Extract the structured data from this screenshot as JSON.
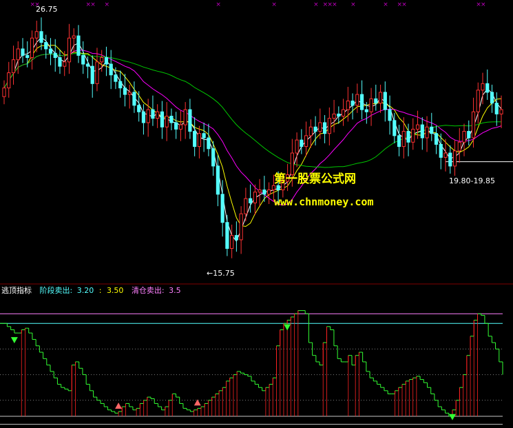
{
  "chart_data": [
    {
      "type": "candlestick",
      "annotations": {
        "high_label": "26.75",
        "low_label": "←15.75",
        "range_label": "19.80-19.85"
      },
      "watermark": {
        "line1": "第一股票公式网",
        "line2": "www.chnmoney.com"
      },
      "price_range": [
        15.2,
        27.4
      ],
      "range_line_price": 20.2,
      "colors": {
        "up": "#ff3232",
        "down": "#54ffff",
        "ma_fast": "#ffffff",
        "ma_mid": "#ffff00",
        "ma_slow": "#ff00ff",
        "ma_long": "#00c800",
        "mark_x": "#c000c0"
      },
      "close": [
        23.6,
        24.3,
        24.9,
        25.4,
        25.1,
        25.0,
        25.9,
        26.2,
        25.7,
        25.4,
        25.2,
        25.0,
        24.6,
        24.8,
        25.9,
        26.0,
        25.1,
        24.7,
        24.6,
        23.8,
        24.8,
        25.0,
        24.7,
        24.2,
        23.9,
        23.6,
        23.3,
        23.4,
        22.8,
        22.5,
        22.0,
        22.6,
        22.2,
        22.5,
        21.8,
        22.3,
        22.0,
        21.7,
        21.9,
        22.6,
        21.6,
        20.9,
        21.5,
        21.3,
        20.8,
        20.0,
        18.7,
        17.4,
        16.2,
        16.8,
        16.6,
        17.8,
        18.5,
        18.3,
        18.8,
        18.9,
        18.7,
        18.9,
        19.1,
        18.9,
        19.3,
        19.6,
        20.6,
        21.2,
        20.9,
        21.4,
        21.8,
        21.6,
        22.0,
        21.5,
        22.2,
        22.4,
        22.3,
        22.6,
        23.0,
        22.8,
        23.3,
        22.6,
        22.5,
        23.1,
        22.9,
        23.4,
        22.6,
        22.1,
        21.4,
        20.9,
        21.6,
        21.1,
        21.7,
        21.9,
        21.3,
        21.8,
        21.5,
        21.0,
        20.4,
        20.6,
        20.0,
        20.7,
        21.1,
        21.6,
        21.3,
        22.5,
        23.5,
        23.8,
        23.4,
        22.9,
        22.4,
        22.6
      ],
      "open": [
        23.2,
        23.6,
        24.3,
        24.9,
        25.4,
        25.1,
        25.0,
        25.9,
        26.2,
        25.7,
        25.4,
        25.2,
        25.0,
        24.6,
        24.8,
        25.9,
        26.0,
        25.1,
        24.7,
        24.6,
        23.8,
        24.8,
        25.0,
        24.7,
        24.2,
        23.9,
        23.6,
        23.3,
        23.4,
        22.8,
        22.5,
        22.0,
        22.6,
        22.2,
        22.5,
        21.8,
        22.3,
        22.0,
        21.7,
        21.9,
        22.6,
        21.6,
        20.9,
        21.5,
        21.3,
        20.8,
        20.0,
        18.7,
        17.4,
        16.2,
        16.8,
        16.6,
        17.8,
        18.5,
        18.3,
        18.8,
        18.9,
        18.7,
        18.9,
        19.1,
        18.9,
        19.3,
        19.6,
        20.6,
        21.2,
        20.9,
        21.4,
        21.8,
        21.6,
        22.0,
        21.5,
        22.2,
        22.4,
        22.3,
        22.6,
        23.0,
        22.8,
        23.3,
        22.6,
        22.5,
        23.1,
        22.9,
        23.4,
        22.6,
        22.1,
        21.4,
        20.9,
        21.6,
        21.1,
        21.7,
        21.9,
        21.3,
        21.8,
        21.5,
        21.0,
        20.4,
        20.6,
        20.0,
        20.7,
        21.1,
        21.6,
        21.3,
        22.5,
        23.5,
        23.8,
        23.4,
        22.9,
        22.4
      ],
      "mark_x_bars": [
        6,
        7,
        18,
        19,
        22,
        46,
        58,
        67,
        69,
        70,
        71,
        75,
        82,
        85,
        86,
        102,
        103
      ]
    },
    {
      "type": "line",
      "title": "逃顶指标",
      "legend": [
        {
          "name": "阶段卖出:",
          "value1": "3.20",
          "sep": ":",
          "value2": "3.50",
          "color": "#54ffff"
        },
        {
          "name": "清仓卖出:",
          "value1": "3.5",
          "color": "#ff80ff"
        }
      ],
      "y_range": [
        0,
        4.0
      ],
      "reference_lines": [
        {
          "value": 3.5,
          "color": "#ff80ff",
          "style": "solid"
        },
        {
          "value": 3.2,
          "color": "#54ffff",
          "style": "solid"
        },
        {
          "value": 2.4,
          "color": "#808080",
          "style": "dotted"
        },
        {
          "value": 1.6,
          "color": "#808080",
          "style": "dotted"
        },
        {
          "value": 0.8,
          "color": "#808080",
          "style": "dotted"
        },
        {
          "value": 0.3,
          "color": "#c8c8c8",
          "style": "solid"
        },
        {
          "value": 0.05,
          "color": "#c8c8c8",
          "style": "solid"
        }
      ],
      "colors": {
        "line": "#33ff33",
        "rise": "#ff2222",
        "arrow_down": "#33ff33",
        "arrow_up": "#ff6666"
      },
      "values": [
        3.2,
        3.2,
        3.1,
        3.0,
        2.9,
        2.9,
        3.0,
        3.05,
        2.9,
        2.7,
        2.5,
        2.3,
        2.1,
        1.9,
        1.7,
        1.5,
        1.3,
        1.2,
        1.15,
        1.1,
        1.9,
        2.0,
        1.8,
        1.6,
        1.3,
        1.1,
        0.9,
        0.8,
        0.7,
        0.6,
        0.5,
        0.45,
        0.4,
        0.45,
        0.6,
        0.7,
        0.6,
        0.5,
        0.55,
        0.7,
        0.8,
        0.9,
        0.85,
        0.7,
        0.6,
        0.5,
        0.6,
        0.8,
        1.0,
        0.9,
        0.7,
        0.55,
        0.5,
        0.45,
        0.5,
        0.55,
        0.6,
        0.7,
        0.8,
        0.9,
        1.0,
        1.1,
        1.2,
        1.4,
        1.5,
        1.6,
        1.7,
        1.65,
        1.6,
        1.55,
        1.4,
        1.3,
        1.2,
        1.1,
        1.2,
        1.3,
        1.5,
        2.5,
        3.0,
        3.2,
        3.3,
        3.4,
        3.5,
        3.6,
        3.6,
        3.5,
        2.6,
        2.2,
        2.0,
        1.9,
        2.6,
        3.1,
        3.0,
        2.5,
        2.1,
        2.0,
        2.0,
        2.2,
        1.9,
        2.2,
        2.3,
        2.0,
        1.7,
        1.5,
        1.4,
        1.3,
        1.2,
        1.1,
        1.0,
        1.0,
        1.1,
        1.2,
        1.3,
        1.4,
        1.45,
        1.5,
        1.55,
        1.45,
        1.35,
        1.2,
        1.0,
        0.8,
        0.6,
        0.5,
        0.4,
        0.3,
        0.5,
        0.8,
        1.2,
        1.6,
        2.2,
        2.8,
        3.3,
        3.5,
        3.45,
        3.2,
        2.8,
        2.6,
        2.4,
        2.0,
        1.6
      ],
      "arrows_down": [
        4,
        80,
        126
      ],
      "arrows_up": [
        33,
        55
      ]
    }
  ]
}
